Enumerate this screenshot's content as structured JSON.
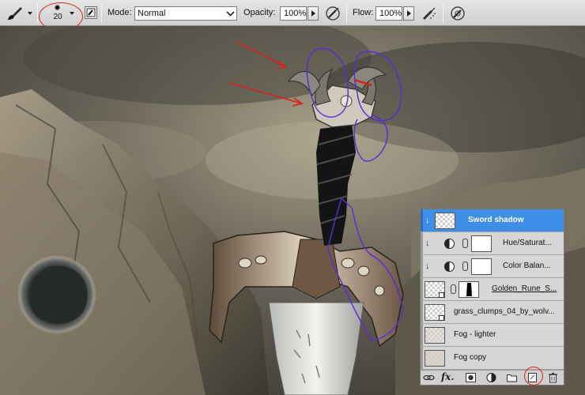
{
  "options_bar": {
    "tool_icon": "brush-icon",
    "brush_size": "20",
    "mode_label": "Mode:",
    "mode_value": "Normal",
    "opacity_label": "Opacity:",
    "opacity_value": "100%",
    "flow_label": "Flow:",
    "flow_value": "100%",
    "icons": [
      "airbrush-toggle-icon",
      "pressure-opacity-icon",
      "airbrush-icon",
      "pressure-size-icon"
    ]
  },
  "layers": [
    {
      "name": "Sword shadow",
      "selected": true,
      "clipped": true,
      "thumb": "transparent"
    },
    {
      "name": "Hue/Saturat...",
      "selected": false,
      "clipped": true,
      "thumb": "white",
      "adjustment": true
    },
    {
      "name": "Color Balan...",
      "selected": false,
      "clipped": true,
      "thumb": "white",
      "adjustment": true
    },
    {
      "name": "Golden_Rune_S...",
      "selected": false,
      "clipped": false,
      "thumb": "transparent",
      "mask": true
    },
    {
      "name": "grass_clumps_04_by_wolv...",
      "selected": false,
      "clipped": false,
      "thumb": "transparent"
    },
    {
      "name": "Fog - lighter",
      "selected": false,
      "clipped": false,
      "thumb": "fog"
    },
    {
      "name": "Fog copy",
      "selected": false,
      "clipped": false,
      "thumb": "fog"
    }
  ],
  "panel_footer_icons": [
    "link-layers-icon",
    "fx-icon",
    "add-mask-icon",
    "adjustment-layer-icon",
    "new-group-icon",
    "new-layer-icon",
    "trash-icon"
  ],
  "fx_text": "fx.",
  "colors": {
    "selection_blue": "#3d8ee6",
    "annotation_red": "#d8221c",
    "annotation_purple": "#5a2bd6"
  }
}
